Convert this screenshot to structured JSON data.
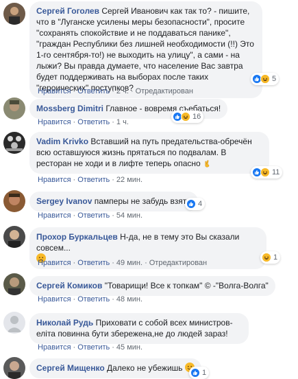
{
  "comments": [
    {
      "author": "Сергей Гоголев",
      "text": "Сергей Иванович как так то? - пишите, что в \"Луганске усилены меры безопасности\", просите \"сохранять спокойствие и не поддаваться панике\", \"граждан Республики без лишней необходимости (!!) Это 1-го сентября-то!) не выходить на улицу\", а сами - на лыжи? Вы правда думаете, что население Вас завтра будет поддерживать на выборах после таких \"героических\" поступков?",
      "like": "Нравится",
      "reply": "Ответить",
      "time": "2 ч.",
      "edited": "Отредактирован",
      "reactions_count": "5",
      "avatar_color": "#5a4a3a"
    },
    {
      "author": "Mossberg Dimitri",
      "text": "Главное - вовремя съебаться!",
      "like": "Нравится",
      "reply": "Ответить",
      "time": "1 ч.",
      "reactions_count": "16",
      "avatar_color": "#6b6b5a"
    },
    {
      "author": "Vadim Krivko",
      "text": "Вставший на путь предательства-обречён всю оставшуюся жизнь прятаться по подвалам. В ресторан не ходи и в лифте теперь опасно",
      "like": "Нравится",
      "reply": "Ответить",
      "time": "22 мин.",
      "reactions_count": "11",
      "avatar_color": "#2a2a2a"
    },
    {
      "author": "Sergey Ivanov",
      "text": "памперы не забудь взять",
      "like": "Нравится",
      "reply": "Ответить",
      "time": "54 мин.",
      "reactions_count": "4",
      "avatar_color": "#7a4a2a"
    },
    {
      "author": "Прохор Буркальцев",
      "text": "Н-да, не в тему это Вы сказали совсем...",
      "like": "Нравится",
      "reply": "Ответить",
      "time": "49 мин.",
      "edited": "Отредактирован",
      "reactions_count": "1",
      "avatar_color": "#3a3a3a"
    },
    {
      "author": "Сергей Комиков",
      "text": "\"Товарищи! Все к топкам\" © -\"Волга-Волга\"",
      "like": "Нравится",
      "reply": "Ответить",
      "time": "48 мин.",
      "avatar_color": "#4a4a3a"
    },
    {
      "author": "Николай Рудь",
      "text": "Приховати с собой всех министров-елiта повинна бути збережена,не до людей зараз!",
      "like": "Нравится",
      "reply": "Ответить",
      "time": "45 мин.",
      "avatar_color": "#e4e6eb"
    },
    {
      "author": "Сергей Мищенко",
      "text": "Далеко не убежишь",
      "reactions_count": "1",
      "avatar_color": "#5a5a5a"
    }
  ],
  "icons": {
    "like": "like-reaction-icon",
    "haha": "haha-reaction-icon",
    "care": "care-reaction-icon"
  },
  "colors": {
    "link": "#385898",
    "bubble": "#f2f3f5",
    "like_blue": "#1877f2",
    "emoji_yellow": "#f7b928"
  }
}
